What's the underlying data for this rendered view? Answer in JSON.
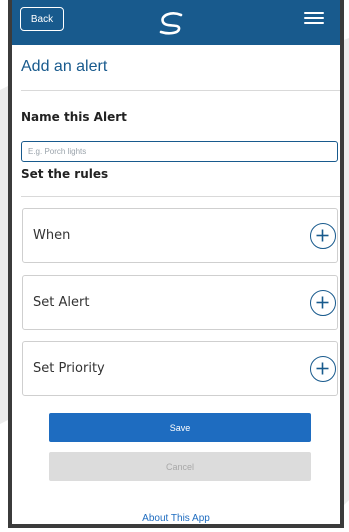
{
  "header": {
    "back_label": "Back",
    "logo_icon": "swirl-logo-icon",
    "menu_icon": "hamburger-menu-icon"
  },
  "page": {
    "title": "Add an alert"
  },
  "name_section": {
    "label": "Name this Alert",
    "input_value": "",
    "input_placeholder": "E.g. Porch lights"
  },
  "rules_section": {
    "label": "Set the rules",
    "items": [
      {
        "label": "When",
        "icon": "plus-circle-icon"
      },
      {
        "label": "Set Alert",
        "icon": "plus-circle-icon"
      },
      {
        "label": "Set Priority",
        "icon": "plus-circle-icon"
      }
    ]
  },
  "actions": {
    "save_label": "Save",
    "cancel_label": "Cancel"
  },
  "footer": {
    "about_label": "About This App"
  },
  "colors": {
    "brand": "#185a8d",
    "primary_button": "#1e6cc0",
    "disabled_button": "#dcdcdc"
  }
}
